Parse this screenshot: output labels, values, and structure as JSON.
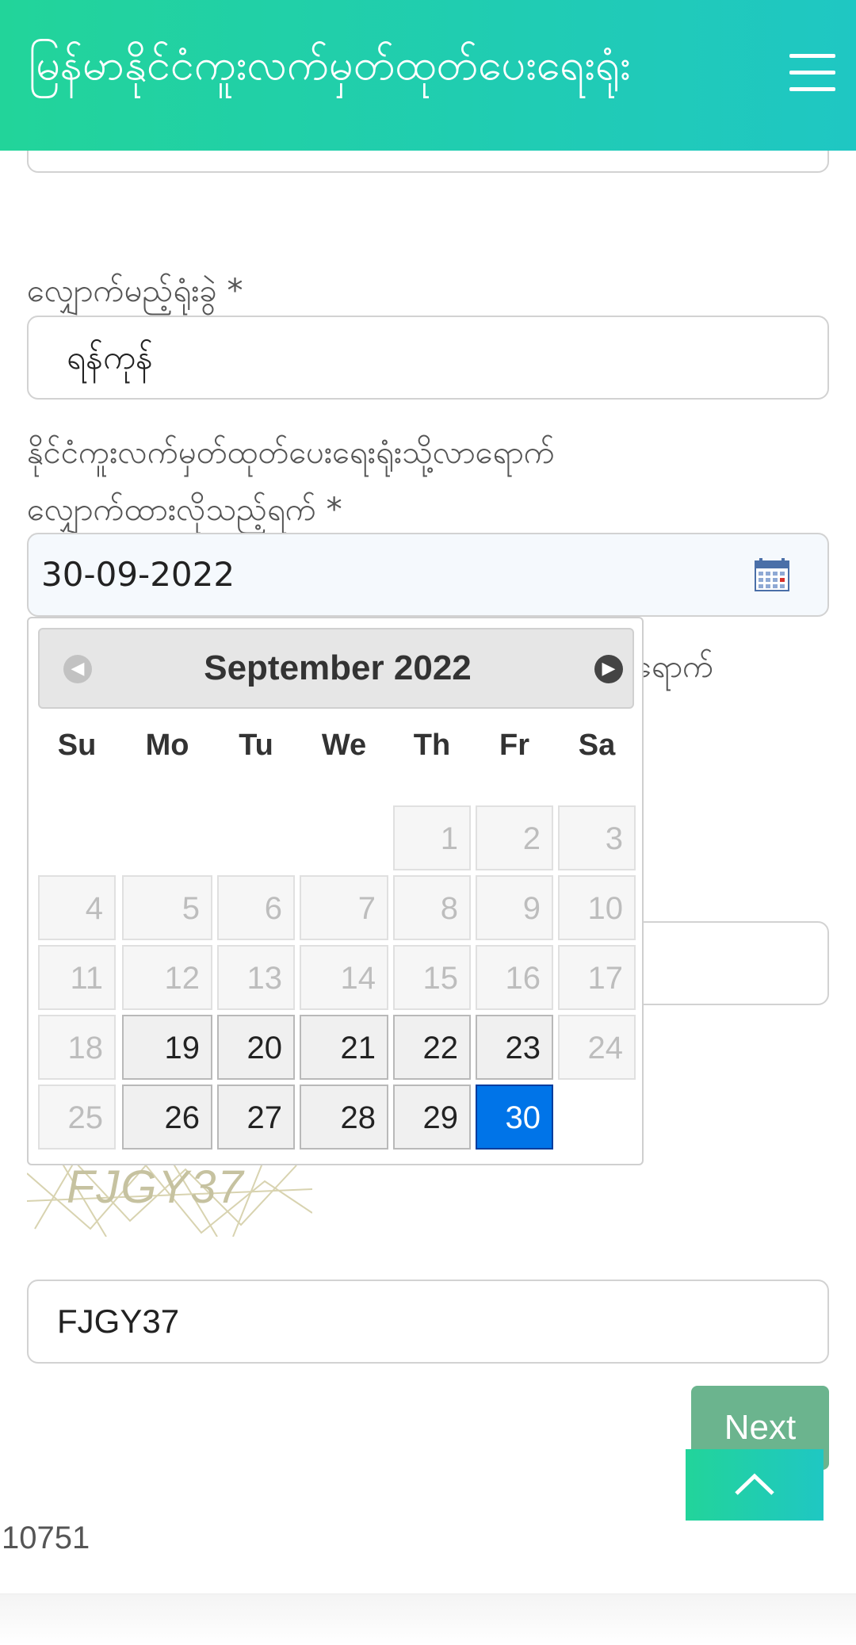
{
  "header": {
    "title": "မြန်မာနိုင်ငံကူးလက်မှတ်ထုတ်ပေးရေးရုံး",
    "menu_icon": "hamburger-menu-icon"
  },
  "form": {
    "office_label": "လျှောက်မည့်ရုံးခွဲ *",
    "office_value": "ရန်ကုန်",
    "date_label_line1": "နိုင်ငံကူးလက်မှတ်ထုတ်ပေးရေးရုံးသို့လာရောက်",
    "date_label_line2": "လျှောက်ထားလိုသည့်ရက် *",
    "date_value": "30-09-2022",
    "hidden_label_peek": "ရောက်",
    "captcha_image_text": "FJGY37",
    "captcha_value": "FJGY37",
    "next_label": "Next"
  },
  "datepicker": {
    "month_year": "September 2022",
    "weekdays": [
      "Su",
      "Mo",
      "Tu",
      "We",
      "Th",
      "Fr",
      "Sa"
    ],
    "days": [
      {
        "d": "1",
        "state": "disabled"
      },
      {
        "d": "2",
        "state": "disabled"
      },
      {
        "d": "3",
        "state": "disabled"
      },
      {
        "d": "4",
        "state": "disabled"
      },
      {
        "d": "5",
        "state": "disabled"
      },
      {
        "d": "6",
        "state": "disabled"
      },
      {
        "d": "7",
        "state": "disabled"
      },
      {
        "d": "8",
        "state": "disabled"
      },
      {
        "d": "9",
        "state": "disabled"
      },
      {
        "d": "10",
        "state": "disabled"
      },
      {
        "d": "11",
        "state": "disabled"
      },
      {
        "d": "12",
        "state": "disabled"
      },
      {
        "d": "13",
        "state": "disabled"
      },
      {
        "d": "14",
        "state": "disabled"
      },
      {
        "d": "15",
        "state": "disabled"
      },
      {
        "d": "16",
        "state": "disabled"
      },
      {
        "d": "17",
        "state": "disabled"
      },
      {
        "d": "18",
        "state": "disabled"
      },
      {
        "d": "19",
        "state": "active"
      },
      {
        "d": "20",
        "state": "active"
      },
      {
        "d": "21",
        "state": "active"
      },
      {
        "d": "22",
        "state": "active"
      },
      {
        "d": "23",
        "state": "active"
      },
      {
        "d": "24",
        "state": "disabled"
      },
      {
        "d": "25",
        "state": "disabled"
      },
      {
        "d": "26",
        "state": "active"
      },
      {
        "d": "27",
        "state": "active"
      },
      {
        "d": "28",
        "state": "active"
      },
      {
        "d": "29",
        "state": "active"
      },
      {
        "d": "30",
        "state": "selected"
      }
    ]
  },
  "footer": {
    "code": "10751"
  },
  "colors": {
    "header_start": "#22d49a",
    "header_end": "#1fc7c3",
    "selected_day": "#0074e8",
    "next_button": "#6bb48e"
  }
}
